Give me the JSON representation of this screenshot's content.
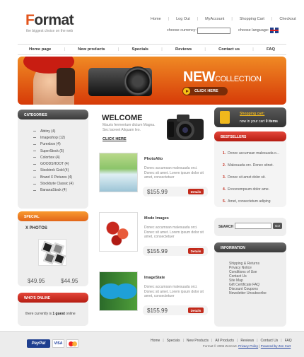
{
  "header": {
    "logo_letter": "F",
    "logo_rest": "ormat",
    "tagline": "the biggest choice on the web",
    "top_links": [
      "Home",
      "Log Out",
      "MyAccount",
      "Shopping Cart",
      "Checkout"
    ],
    "currency_label": "choose currency:",
    "language_label": "choose language:"
  },
  "nav": [
    "Home page",
    "New products",
    "Specials",
    "Reviews",
    "Contact us",
    "FAQ"
  ],
  "banner": {
    "new": "NEW",
    "collection": "COLLECTION",
    "button": "CLICK HERE"
  },
  "categories": {
    "title": "CATEGORIES",
    "items": [
      "Abtiny (4)",
      "Imageshop (12)",
      "Purexbox (4)",
      "SuperStock (5)",
      "Colorbox (4)",
      "GOODSHOOT (4)",
      "Stocktrek Gold (4)",
      "Brand X Pictures (4)",
      "Stockbyte Classic (4)",
      "BananaStock (4)"
    ]
  },
  "special": {
    "title": "SPECIAL",
    "product": "X PHOTOS",
    "old_price": "$49.95",
    "new_price": "$44.95"
  },
  "who": {
    "title": "WHO'S ONLINE",
    "text_pre": "there currently is ",
    "text_bold": "1 guest",
    "text_post": " online"
  },
  "welcome": {
    "title": "WELCOME",
    "text": "Mauris fermentum dictum Magna. Sec laoreet Aliquam leo.",
    "link": "CLICK HERE"
  },
  "products": [
    {
      "name": "PhotoAlto",
      "desc": "Donec accumsan malesuada orci. Donec sit amet. Lorem ipsum dolor sit amet, consectetuer",
      "price": "$155.99",
      "details": "Details"
    },
    {
      "name": "Mode Images",
      "desc": "Donec accumsan malesuada orci. Donec sit amet. Lorem ipsum dolor sit amet, consectetuer",
      "price": "$155.99",
      "details": "Details"
    },
    {
      "name": "ImageState",
      "desc": "Donec accumsan malesuada orci. Donec sit amet. Lorem ipsum dolor sit amet, consectetuer",
      "price": "$155.99",
      "details": "Details"
    }
  ],
  "cart": {
    "title": "Shopping cart:",
    "text_pre": "now in your cart ",
    "text_bold": "0 items"
  },
  "bestsellers": {
    "title": "BESTSELLERS",
    "items": [
      "Donec accumsan malesuada o...",
      "Malesuada orc. Donec sitnet.",
      "Donec sit amet dolor sit.",
      "Erocerempsum dolor ame.",
      "Amet, consectetum adiping"
    ]
  },
  "search": {
    "label": "SEARCH",
    "go": "Go!"
  },
  "information": {
    "title": "INFORMATION",
    "items": [
      "Shipping & Returns",
      "Privacy Notice",
      "Conditions of Use",
      "Contact Us",
      "Site Map",
      "Gift Certificate FAQ",
      "Discount Coupons",
      "Newsletter Unsubscribe"
    ]
  },
  "footer": {
    "paypal": "PayPal",
    "visa": "VISA",
    "links": [
      "Home",
      "Specials",
      "New Products",
      "All Products",
      "Reviews",
      "Contact Us",
      "FAQ"
    ],
    "copyright_pre": "Format © 2006 ZenCart. ",
    "copyright_link": "Privacy Policy",
    "copyright_mid": " | ",
    "copyright_link2": "Powered by Zen Cart"
  }
}
